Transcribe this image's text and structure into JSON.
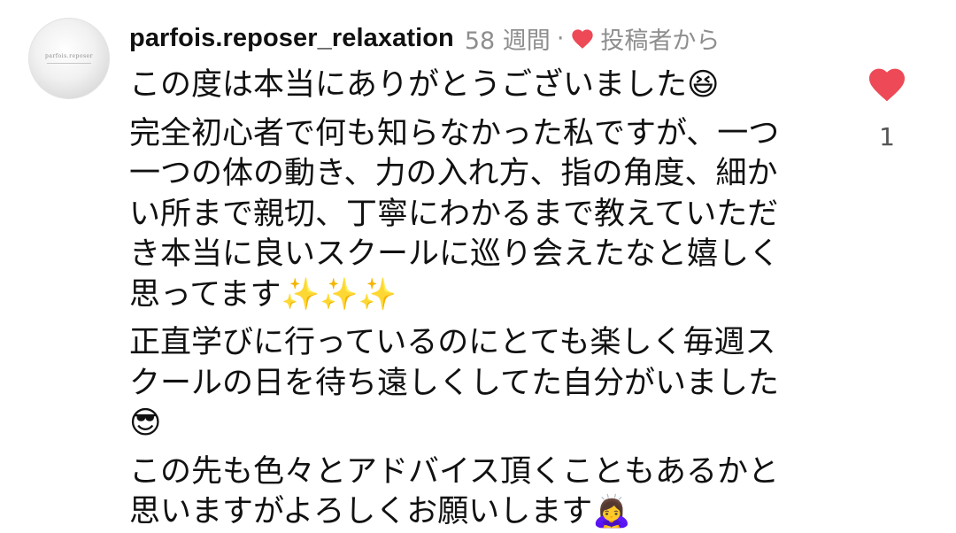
{
  "comment": {
    "avatar": {
      "logo_text": "parfois.reposer"
    },
    "username": "parfois.reposer_relaxation",
    "timestamp": "58 週間",
    "separator": "·",
    "liked_by_label": "投稿者から",
    "liked_icon": "heart-icon",
    "accent_color": "#ed4956",
    "paragraphs": [
      {
        "lines": [
          "この度は本当にありがとうございました😆"
        ]
      },
      {
        "lines": [
          "完全初心者で何も知らなかった私ですが、一つ",
          "一つの体の動き、力の入れ方、指の角度、細か",
          "い所まで親切、丁寧にわかるまで教えていただ",
          "き本当に良いスクールに巡り会えたなと嬉しく",
          "思ってます✨✨✨"
        ]
      },
      {
        "lines": [
          "正直学びに行っているのにとても楽しく毎週ス",
          "クールの日を待ち遠しくしてた自分がいました",
          "😎"
        ]
      },
      {
        "lines": [
          "この先も色々とアドバイス頂くこともあるかと",
          "思いますがよろしくお願いします🙇‍♀️"
        ]
      }
    ],
    "like": {
      "icon": "heart-icon",
      "liked": true,
      "count": "1"
    }
  }
}
